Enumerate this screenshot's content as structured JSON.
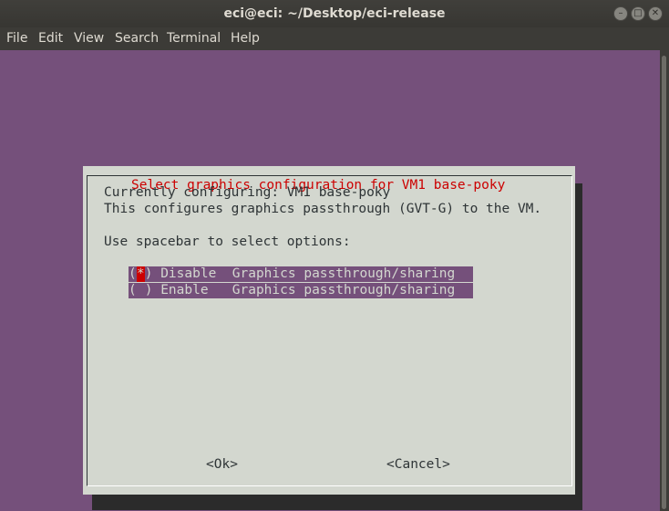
{
  "window": {
    "title": "eci@eci: ~/Desktop/eci-release",
    "controls": {
      "minimize": "–",
      "maximize": "□",
      "close": "✕"
    }
  },
  "menubar": {
    "items": [
      "File",
      "Edit",
      "View",
      "Search",
      "Terminal",
      "Help"
    ]
  },
  "dialog": {
    "title": "Select graphics configuration for VM1 base-poky",
    "lines": [
      "Currently configuring: VM1 base-poky",
      "This configures graphics passthrough (GVT-G) to the VM.",
      "Use spacebar to select options:"
    ],
    "options": [
      {
        "open": "(",
        "mark": "*",
        "close": ")",
        "label": " Disable  Graphics passthrough/sharing",
        "selected": true
      },
      {
        "open": "(",
        "mark": " ",
        "close": ")",
        "label": " Enable   Graphics passthrough/sharing",
        "selected": false
      }
    ],
    "ok_label": "<Ok>",
    "cancel_label": "<Cancel>"
  },
  "colors": {
    "terminal_bg": "#75507b",
    "dialog_bg": "#d3d7cf",
    "title_text": "#cc0000",
    "selected_mark_bg": "#cc0000"
  }
}
